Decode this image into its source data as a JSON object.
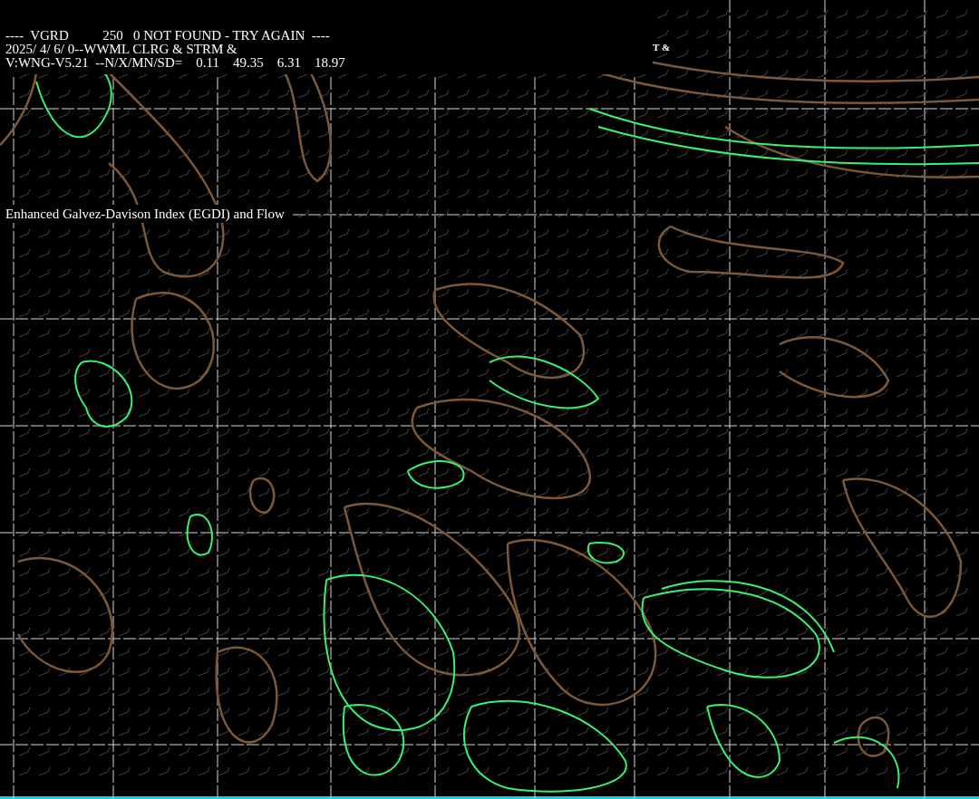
{
  "header_lines": [
    "----  VGRD          250   0 NOT FOUND - TRY AGAIN  ----",
    "2025/ 4/ 6/ 0--WWML CLRG & STRM &",
    "V:WNG-V5.21  --N/X/MN/SD=    0.11    49.35    6.31    18.97"
  ],
  "corner_label": "T &",
  "map_title": "Enhanced Galvez-Davison Index (EGDI) and Flow"
}
